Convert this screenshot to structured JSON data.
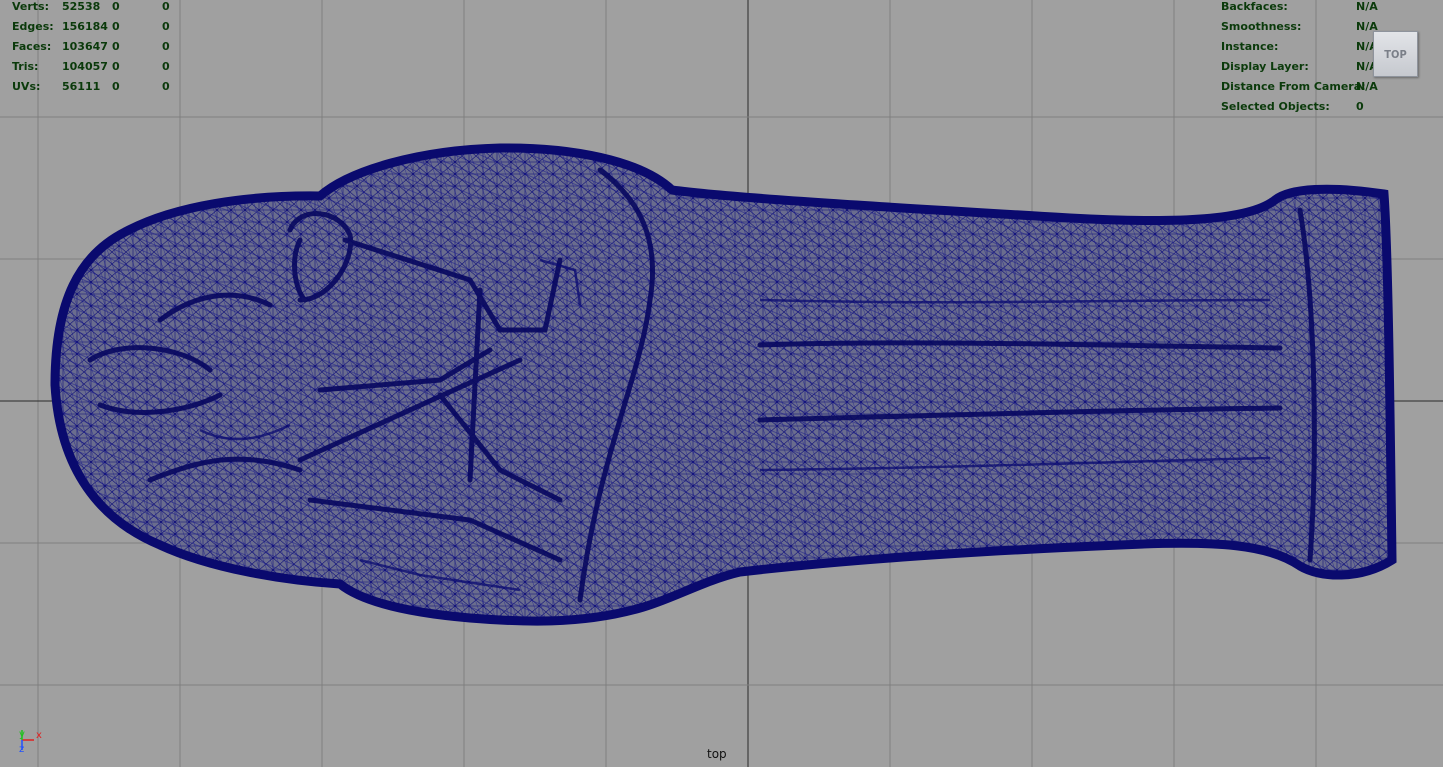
{
  "hud_left": {
    "rows": [
      {
        "label": "Verts:",
        "v1": "52538",
        "v2": "0",
        "v3": "0"
      },
      {
        "label": "Edges:",
        "v1": "156184",
        "v2": "0",
        "v3": "0"
      },
      {
        "label": "Faces:",
        "v1": "103647",
        "v2": "0",
        "v3": "0"
      },
      {
        "label": "Tris:",
        "v1": "104057",
        "v2": "0",
        "v3": "0"
      },
      {
        "label": "UVs:",
        "v1": "56111",
        "v2": "0",
        "v3": "0"
      }
    ]
  },
  "hud_right": {
    "rows": [
      {
        "label": "Backfaces:",
        "value": "N/A"
      },
      {
        "label": "Smoothness:",
        "value": "N/A"
      },
      {
        "label": "Instance:",
        "value": "N/A"
      },
      {
        "label": "Display Layer:",
        "value": "N/A"
      },
      {
        "label": "Distance From Camera:",
        "value": "N/A"
      },
      {
        "label": "Selected Objects:",
        "value": "0"
      }
    ]
  },
  "view_cube": {
    "label": "TOP"
  },
  "camera": {
    "name": "top"
  },
  "axis": {
    "x": "x",
    "y": "y",
    "z": "z"
  },
  "colors": {
    "viewport_bg": "#a0a0a0",
    "grid_line": "#7f7f7f",
    "axis_line": "#2a2a2a",
    "mesh_fill": "#6a6d8e",
    "wire": "#0a0a78",
    "hud_text": "#0b3a0b"
  }
}
